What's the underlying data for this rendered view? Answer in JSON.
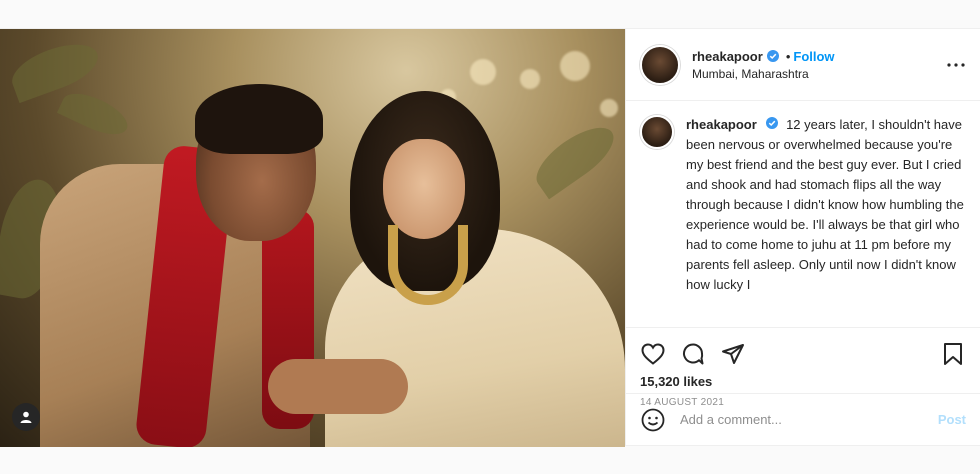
{
  "post": {
    "username": "rheakapoor",
    "follow_label": "Follow",
    "separator": "•",
    "location": "Mumbai, Maharashtra",
    "caption_username": "rheakapoor",
    "caption_text": "12 years later, I shouldn't have been nervous or overwhelmed because you're my best friend and the best guy ever. But I cried and shook and had stomach flips all the way through because I didn't know how humbling the experience would be. I'll always be that girl who had to come home to juhu at 11 pm before my parents fell asleep. Only until now I didn't know how lucky I",
    "likes": "15,320 likes",
    "date": "14 AUGUST 2021"
  },
  "comment": {
    "placeholder": "Add a comment...",
    "post_label": "Post"
  },
  "colors": {
    "accent": "#0095f6",
    "post_disabled": "#b2dffc",
    "verified": "#3897f0",
    "dupatta": "#c11a22"
  },
  "icons": {
    "verified": "verified-badge-icon",
    "more": "more-options-icon",
    "like": "heart-icon",
    "comment": "comment-icon",
    "share": "paper-plane-icon",
    "save": "bookmark-icon",
    "emoji": "smiley-icon",
    "user_tag": "user-tag-icon"
  }
}
